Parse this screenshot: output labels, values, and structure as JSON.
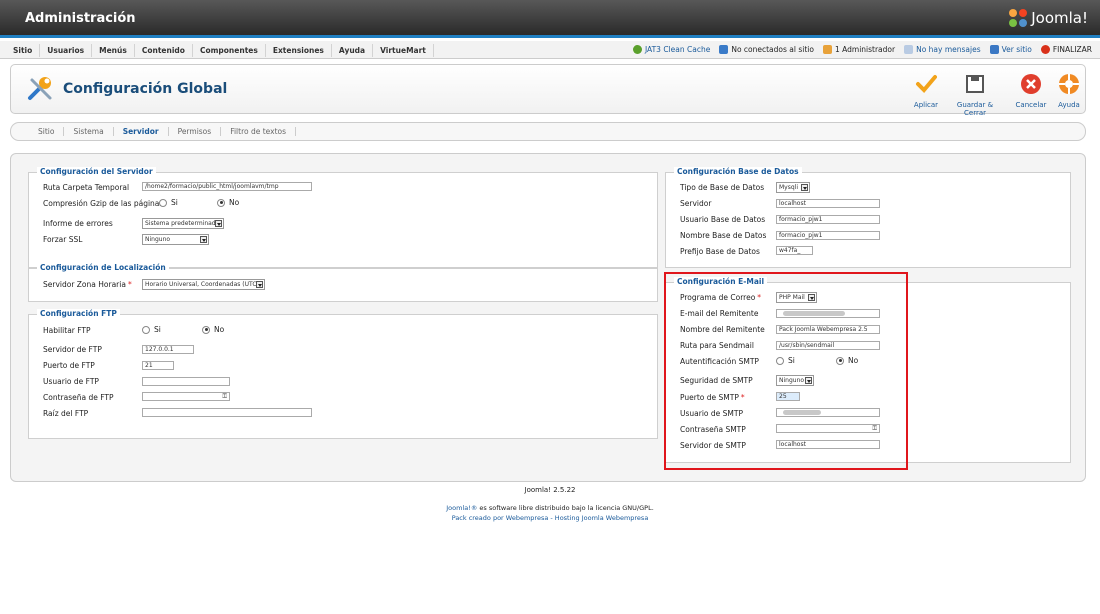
{
  "header": {
    "title": "Administración",
    "logo": "Joomla!"
  },
  "menu": [
    "Sitio",
    "Usuarios",
    "Menús",
    "Contenido",
    "Componentes",
    "Extensiones",
    "Ayuda",
    "VirtueMart"
  ],
  "status": {
    "clean_cache": "JAT3 Clean Cache",
    "not_connected": "No conectados al sitio",
    "admins": "1 Administrador",
    "messages": "No hay mensajes",
    "view_site": "Ver sitio",
    "logout": "FINALIZAR"
  },
  "page": {
    "title": "Configuración Global"
  },
  "toolbar": {
    "apply": "Aplicar",
    "save_close": "Guardar & Cerrar",
    "cancel": "Cancelar",
    "help": "Ayuda"
  },
  "tabs": [
    "Sitio",
    "Sistema",
    "Servidor",
    "Permisos",
    "Filtro de textos"
  ],
  "server": {
    "legend": "Configuración del Servidor",
    "temp_path_label": "Ruta Carpeta Temporal",
    "temp_path_value": "/home2/formacio/public_html/joomlavm/tmp",
    "gzip_label": "Compresión Gzip de las páginas",
    "yes": "Si",
    "no": "No",
    "errors_label": "Informe de errores",
    "errors_value": "Sistema predeterminado",
    "ssl_label": "Forzar SSL",
    "ssl_value": "Ninguno"
  },
  "locale": {
    "legend": "Configuración de Localización",
    "tz_label": "Servidor Zona Horaria",
    "tz_value": "Horario Universal, Coordenadas (UTC)"
  },
  "ftp": {
    "legend": "Configuración FTP",
    "enable_label": "Habilitar FTP",
    "yes": "Si",
    "no": "No",
    "server_label": "Servidor de FTP",
    "server_value": "127.0.0.1",
    "port_label": "Puerto de FTP",
    "port_value": "21",
    "user_label": "Usuario de FTP",
    "pass_label": "Contraseña de FTP",
    "root_label": "Raíz del FTP"
  },
  "db": {
    "legend": "Configuración Base de Datos",
    "type_label": "Tipo de Base de Datos",
    "type_value": "Mysqli",
    "host_label": "Servidor",
    "host_value": "localhost",
    "user_label": "Usuario Base de Datos",
    "user_value": "formacio_pjw1",
    "name_label": "Nombre Base de Datos",
    "name_value": "formacio_pjw1",
    "prefix_label": "Prefijo Base de Datos",
    "prefix_value": "w47fa_"
  },
  "mail": {
    "legend": "Configuración E-Mail",
    "mailer_label": "Programa de Correo",
    "mailer_value": "PHP Mail",
    "from_email_label": "E-mail del Remitente",
    "from_name_label": "Nombre del Remitente",
    "from_name_value": "Pack Joomla Webempresa 2.5",
    "sendmail_label": "Ruta para Sendmail",
    "sendmail_value": "/usr/sbin/sendmail",
    "smtp_auth_label": "Autentificación SMTP",
    "yes": "Si",
    "no": "No",
    "smtp_secure_label": "Seguridad de SMTP",
    "smtp_secure_value": "Ninguno",
    "smtp_port_label": "Puerto de SMTP",
    "smtp_port_value": "25",
    "smtp_user_label": "Usuario de SMTP",
    "smtp_pass_label": "Contraseña SMTP",
    "smtp_host_label": "Servidor de SMTP",
    "smtp_host_value": "localhost"
  },
  "footer": {
    "version": "Joomla! 2.5.22",
    "license_link": "Joomla!®",
    "license_text": " es software libre distribuido bajo la licencia GNU/GPL.",
    "pack_text": "Pack creado por Webempresa - Hosting Joomla Webempresa"
  }
}
